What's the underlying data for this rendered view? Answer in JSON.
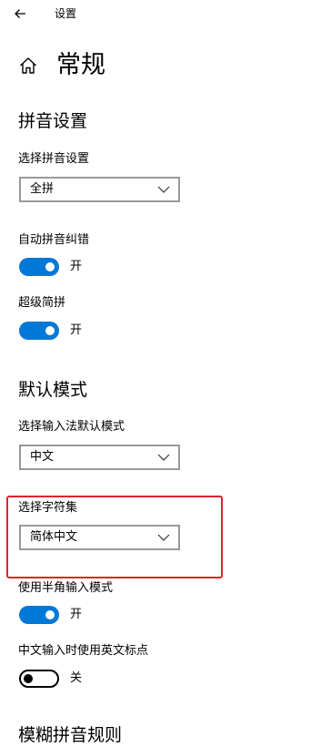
{
  "app": {
    "title": "设置"
  },
  "header": {
    "page_title": "常规"
  },
  "pinyin_section": {
    "title": "拼音设置",
    "select_label": "选择拼音设置",
    "select_value": "全拼",
    "fuzzy_label": "自动拼音纠错",
    "fuzzy_state": "开",
    "super_label": "超级简拼",
    "super_state": "开"
  },
  "default_mode_section": {
    "title": "默认模式",
    "mode_label": "选择输入法默认模式",
    "mode_value": "中文",
    "charset_label": "选择字符集",
    "charset_value": "简体中文",
    "halfwidth_label": "使用半角输入模式",
    "halfwidth_state": "开",
    "punct_label": "中文输入时使用英文标点",
    "punct_state": "关"
  },
  "next_section": {
    "title": "模糊拼音规则"
  },
  "colors": {
    "accent": "#0078d7",
    "highlight": "#d9262b"
  },
  "icons": {
    "back": "back-arrow-icon",
    "home": "home-icon",
    "dropdown": "chevron-down-icon"
  }
}
